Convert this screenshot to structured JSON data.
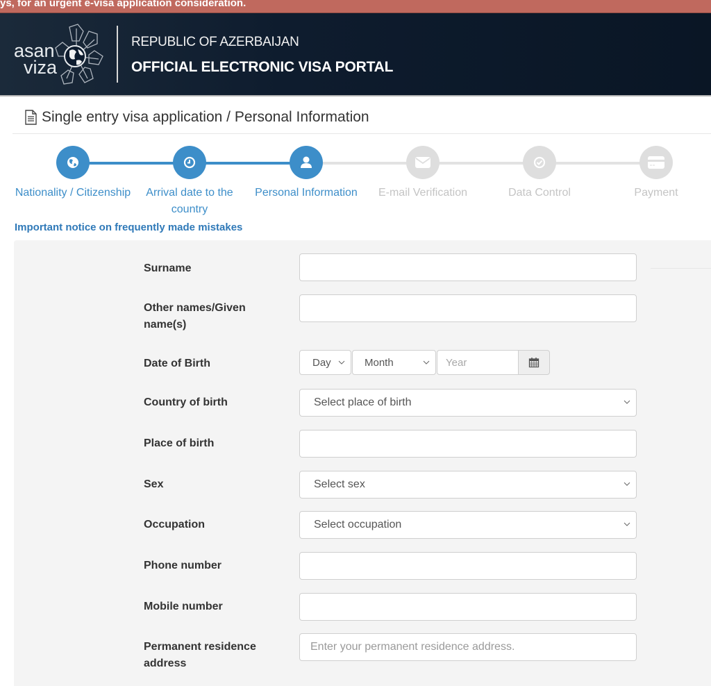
{
  "alert": {
    "text": "ys, for an urgent e-visa application consideration."
  },
  "header": {
    "logo_line1": "asan",
    "logo_line2": "viza",
    "country": "REPUBLIC OF AZERBAIJAN",
    "portal": "OFFICIAL ELECTRONIC VISA PORTAL"
  },
  "page": {
    "title": "Single entry visa application / Personal Information",
    "title_icon": "file-text-icon"
  },
  "steps": [
    {
      "label": "Nationality / Citizenship",
      "icon": "globe-icon",
      "status": "done"
    },
    {
      "label": "Arrival date to the country",
      "icon": "clock-icon",
      "status": "done"
    },
    {
      "label": "Personal Information",
      "icon": "user-icon",
      "status": "current"
    },
    {
      "label": "E-mail Verification",
      "icon": "envelope-icon",
      "status": "pending"
    },
    {
      "label": "Data Control",
      "icon": "check-circle-icon",
      "status": "pending"
    },
    {
      "label": "Payment",
      "icon": "credit-card-icon",
      "status": "pending"
    }
  ],
  "notice_link": "Important notice on frequently made mistakes",
  "form": {
    "surname": {
      "label": "Surname",
      "value": "",
      "placeholder": ""
    },
    "given_names": {
      "label": "Other names/Given name(s)",
      "value": "",
      "placeholder": ""
    },
    "dob": {
      "label": "Date of Birth",
      "day": "Day",
      "month": "Month",
      "year_placeholder": "Year",
      "calendar_icon": "calendar-icon"
    },
    "country_of_birth": {
      "label": "Country of birth",
      "selected": "Select place of birth"
    },
    "place_of_birth": {
      "label": "Place of birth",
      "value": "",
      "placeholder": ""
    },
    "sex": {
      "label": "Sex",
      "selected": "Select sex"
    },
    "occupation": {
      "label": "Occupation",
      "selected": "Select occupation"
    },
    "phone": {
      "label": "Phone number",
      "value": "",
      "placeholder": ""
    },
    "mobile": {
      "label": "Mobile number",
      "value": "",
      "placeholder": ""
    },
    "address": {
      "label": "Permanent residence address",
      "value": "",
      "placeholder": "Enter your permanent residence address."
    }
  },
  "colors": {
    "alert_bg": "#c0695e",
    "header_bg": "#0e1c2e",
    "accent": "#3d8ec9",
    "pending": "#dedede",
    "link": "#2f79b8",
    "form_bg": "#f4f4f4"
  }
}
